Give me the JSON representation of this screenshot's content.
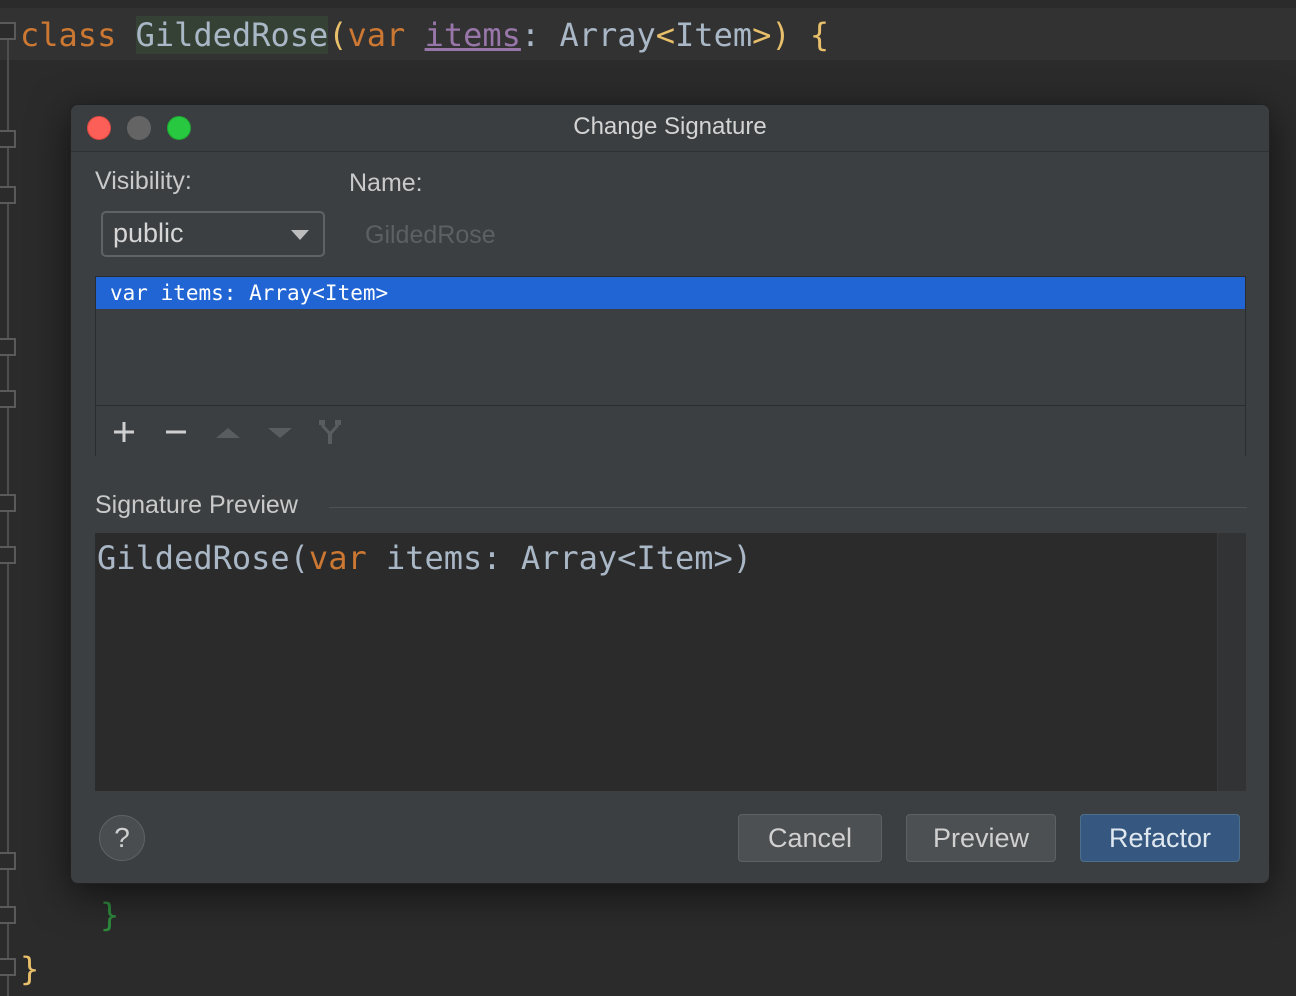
{
  "editor": {
    "line1": {
      "kw_class": "class",
      "class_name": "GildedRose",
      "open_paren": "(",
      "kw_var": "var",
      "param_name": "items",
      "colon": ": ",
      "type": "Array",
      "lt": "<",
      "type_arg": "Item",
      "gt": ">",
      "close_paren": ")",
      "open_brace": "{"
    },
    "inner_close_brace": "}",
    "outer_close_brace": "}"
  },
  "dialog": {
    "title": "Change Signature",
    "visibility_label": "Visibility:",
    "visibility_value": "public",
    "name_label": "Name:",
    "name_value": "GildedRose",
    "parameters": [
      {
        "text": "var items: Array<Item>"
      }
    ],
    "toolbar_icons": [
      "add-icon",
      "remove-icon",
      "move-up-icon",
      "move-down-icon",
      "propagate-icon"
    ],
    "preview_section_title": "Signature Preview",
    "preview": {
      "name": "GildedRose",
      "open": "(",
      "kw": "var",
      "rest": " items: Array<Item>)"
    },
    "help_label": "?",
    "buttons": {
      "cancel": "Cancel",
      "preview": "Preview",
      "refactor": "Refactor"
    }
  },
  "colors": {
    "keyword": "#cc7832",
    "selection": "#2065d3",
    "default_button": "#365880",
    "param_purple": "#9876aa"
  }
}
